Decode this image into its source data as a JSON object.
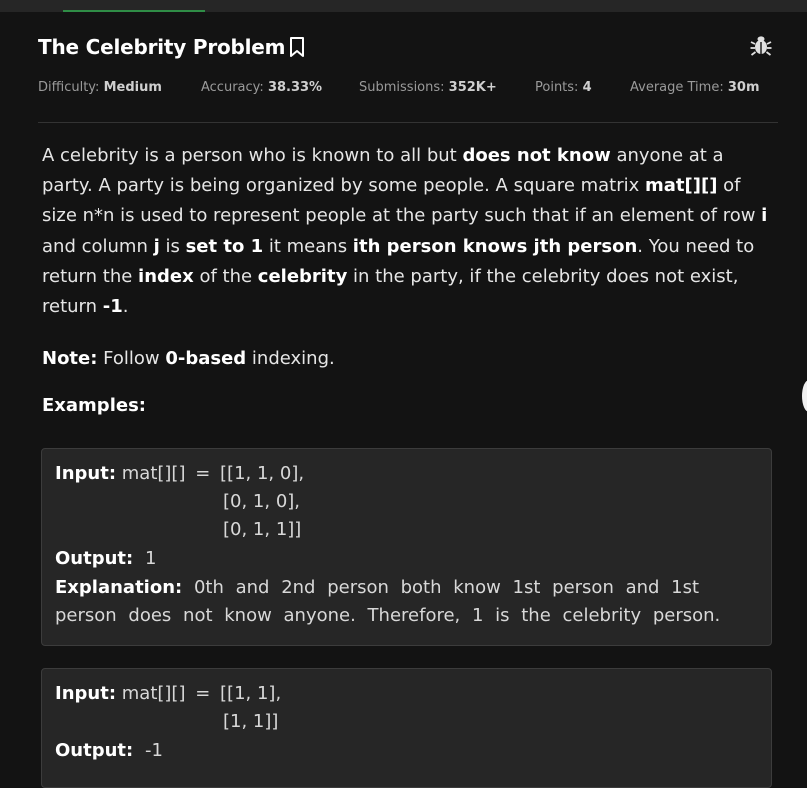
{
  "problem": {
    "title": "The Celebrity Problem",
    "meta": {
      "difficulty_label": "Difficulty:",
      "difficulty_value": "Medium",
      "accuracy_label": "Accuracy:",
      "accuracy_value": "38.33%",
      "submissions_label": "Submissions:",
      "submissions_value": "352K+",
      "points_label": "Points:",
      "points_value": "4",
      "avg_time_label": "Average Time:",
      "avg_time_value": "30m"
    },
    "statement": {
      "p1": "A celebrity is a person who is known to all but ",
      "b1": "does not know",
      "p2": " anyone at a party. A party is being organized by some people. A square matrix ",
      "b2": "mat[][]",
      "p3": " of size n*n is used to represent people at the party such that if an element of row ",
      "b3": "i",
      "p4": " and column ",
      "b4": "j",
      "p5": " is ",
      "b5": "set to 1",
      "p6": " it means ",
      "b6": "ith person knows jth person",
      "p7": ". You need to return the ",
      "b7": "index",
      "p8": " of the ",
      "b8": "celebrity",
      "p9": " in the party, if the celebrity does not exist, return ",
      "b9": "-1",
      "p10": "."
    },
    "note": {
      "label": "Note:",
      "t1": " Follow ",
      "b1": "0-based",
      "t2": " indexing."
    },
    "examples_heading": "Examples:",
    "examples": [
      {
        "input_label": "Input:",
        "input_var": "mat[][]",
        "input_eq": "=",
        "input_lines": [
          "[[1, 1, 0],",
          "[0, 1, 0],",
          "[0, 1, 1]]"
        ],
        "output_label": "Output:",
        "output_value": "1",
        "explanation_label": "Explanation:",
        "explanation_text": "0th and 2nd person both know 1st person and 1st person does not know anyone. Therefore, 1 is the celebrity person."
      },
      {
        "input_label": "Input:",
        "input_var": "mat[][]",
        "input_eq": "=",
        "input_lines": [
          "[[1, 1],",
          "[1, 1]]"
        ],
        "output_label": "Output:",
        "output_value": "-1"
      }
    ]
  },
  "icons": {
    "bookmark": "bookmark-icon",
    "bug": "bug-icon"
  }
}
